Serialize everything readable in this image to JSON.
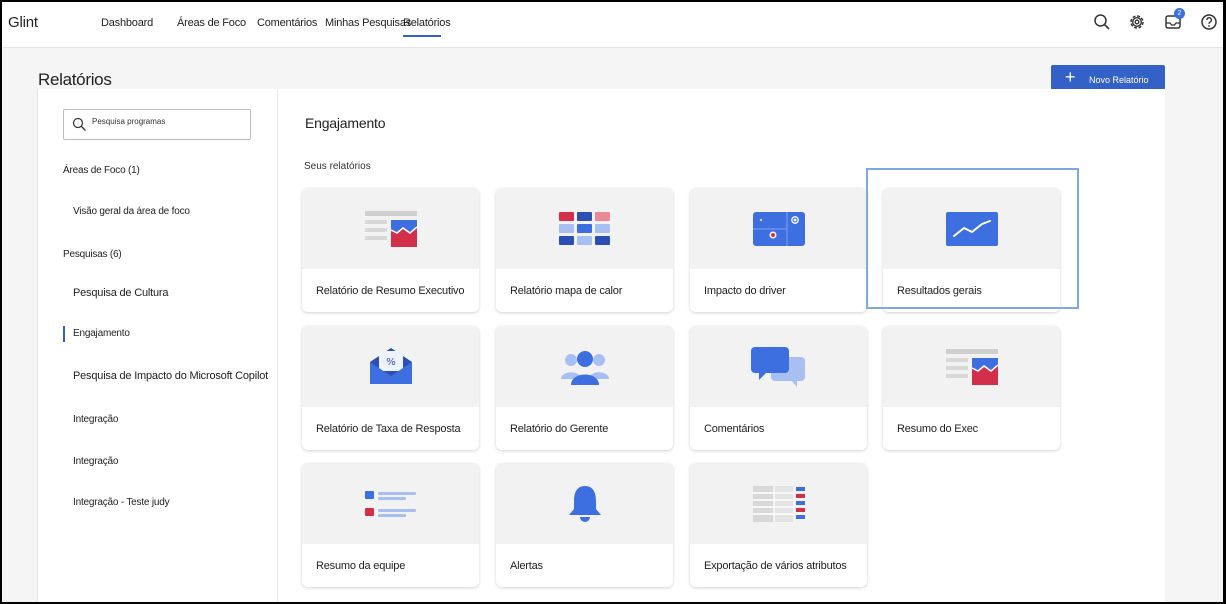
{
  "app": {
    "name": "Glint"
  },
  "nav": {
    "items": [
      "Dashboard",
      "Áreas de Foco",
      "Comentários",
      "Minhas Pesquisas",
      "Relatórios"
    ],
    "active_index": 4
  },
  "header_icons": {
    "search": "search-icon",
    "settings": "gear-icon",
    "inbox": "inbox-icon",
    "inbox_badge": "2",
    "help": "help-icon"
  },
  "page": {
    "title": "Relatórios",
    "new_report_label": "Novo Relatório"
  },
  "sidebar": {
    "search_placeholder": "Pesquisa programas",
    "focus_heading": "Áreas de Foco (1)",
    "focus_items": [
      "Visão geral da área de foco"
    ],
    "surveys_heading": "Pesquisas (6)",
    "survey_items": [
      "Pesquisa de Cultura",
      "Engajamento",
      "Pesquisa de Impacto do Microsoft Copilot",
      "Integração",
      "Integração",
      "Integração - Teste judy"
    ],
    "active_survey_index": 1
  },
  "main": {
    "section_title": "Engajamento",
    "subtitle": "Seus relatórios",
    "tiles": [
      {
        "label": "Relatório de Resumo Executivo",
        "icon": "exec-summary-icon"
      },
      {
        "label": "Relatório mapa de calor",
        "icon": "heatmap-icon"
      },
      {
        "label": "Impacto do driver",
        "icon": "driver-impact-icon"
      },
      {
        "label": "Resultados gerais",
        "icon": "trend-line-icon"
      },
      {
        "label": "Relatório de Taxa de Resposta",
        "icon": "response-rate-icon"
      },
      {
        "label": "Relatório do Gerente",
        "icon": "manager-group-icon"
      },
      {
        "label": "Comentários",
        "icon": "comments-icon"
      },
      {
        "label": "Resumo do Exec",
        "icon": "exec-summary-icon"
      },
      {
        "label": "Resumo da equipe",
        "icon": "team-summary-icon"
      },
      {
        "label": "Alertas",
        "icon": "bell-icon"
      },
      {
        "label": "Exportação de vários atributos",
        "icon": "multi-attribute-export-icon"
      }
    ],
    "highlighted_index": 3
  },
  "colors": {
    "accent": "#3361c7",
    "highlight": "#7fa8e3",
    "red": "#d2304a"
  }
}
